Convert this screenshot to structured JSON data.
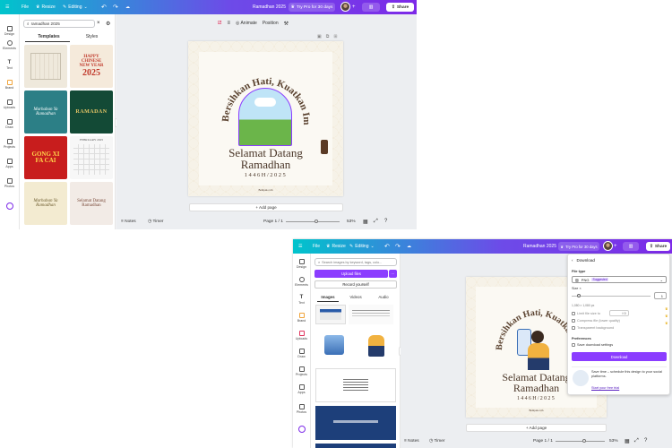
{
  "win1": {
    "topbar": {
      "file": "File",
      "resize": "Resize",
      "editing": "Editing",
      "doc_title": "Ramadhan 2025",
      "try_pro": "Try Pro for 30 days",
      "share": "Share"
    },
    "rail": [
      "Design",
      "Elements",
      "Text",
      "Brand",
      "Uploads",
      "Draw",
      "Projects",
      "Apps",
      "Photos"
    ],
    "search": {
      "value": "ramadhan 2025"
    },
    "tabs": {
      "templates": "Templates",
      "styles": "Styles"
    },
    "thumbs": [
      {
        "l1": "",
        "l2": "",
        "bg": "#efe9dc",
        "fg": "#7a6a55"
      },
      {
        "l1": "HAPPY CHINESE NEW YEAR",
        "l2": "2025",
        "bg": "#f5eadb",
        "fg": "#c0392b"
      },
      {
        "l1": "Marhaban Ya",
        "l2": "Ramadhan",
        "bg": "#2c7f86",
        "fg": "#ffffff"
      },
      {
        "l1": "RAMADAN",
        "l2": "",
        "bg": "#134a36",
        "fg": "#e8c766"
      },
      {
        "l1": "GONG XI",
        "l2": "FA CAI",
        "bg": "#c81d1d",
        "fg": "#ffd54a"
      },
      {
        "l1": "FEBRUARY 2025",
        "l2": "",
        "bg": "#f7f7f7",
        "fg": "#555555"
      },
      {
        "l1": "Marhaban Ya",
        "l2": "Ramadhan",
        "bg": "#f3ebd1",
        "fg": "#6b5a2c"
      },
      {
        "l1": "Selamat Datang",
        "l2": "Ramadhan",
        "bg": "#f2ebe6",
        "fg": "#7a4a3a"
      }
    ],
    "toolbar": {
      "animate": "Animate",
      "position": "Position"
    },
    "design": {
      "arc_text": "Bersihkan Hati, Kuatkan Iman",
      "title1": "Selamat Datang",
      "title2": "Ramadhan",
      "year": "1446H/2025",
      "brand": "Bempak.com"
    },
    "add_page": "+ Add page",
    "bottom": {
      "notes": "Notes",
      "timer": "Timer",
      "page": "Page 1 / 1",
      "zoom": "53%"
    }
  },
  "win2": {
    "topbar": {
      "file": "File",
      "resize": "Resize",
      "editing": "Editing",
      "doc_title": "Ramadhan 2025",
      "try_pro": "Try Pro for 30 days",
      "share": "Share"
    },
    "rail": [
      "Design",
      "Elements",
      "Text",
      "Brand",
      "Uploads",
      "Draw",
      "Projects",
      "Apps",
      "Photos"
    ],
    "search": {
      "placeholder": "Search images by keyword, tags, colo..."
    },
    "upload_files": "Upload files",
    "record": "Record yourself",
    "tabs": {
      "images": "Images",
      "videos": "Videos",
      "audio": "Audio"
    },
    "design": {
      "arc_text": "Bersihkan Hati, Kuatkan Iman",
      "title1": "Selamat Datang",
      "title2": "Ramadhan",
      "year": "1446H/2025",
      "brand": "Bempak.com"
    },
    "add_page": "+ Add page",
    "bottom": {
      "notes": "Notes",
      "timer": "Timer",
      "page": "Page 1 / 1",
      "zoom": "53%"
    },
    "download": {
      "title": "Download",
      "file_type_label": "File type",
      "file_type": "PNG",
      "suggested": "Suggested",
      "size_label": "Size ×",
      "size_value": "1",
      "dims": "1,080 × 1,080 px",
      "limit": "Limit file size to",
      "limit_unit": "KB",
      "compress": "Compress file (lower quality)",
      "transparent": "Transparent background",
      "prefs": "Preferences",
      "save_settings": "Save download settings",
      "button": "Download",
      "promo": "Save time – schedule this design to your social platforms.",
      "promo_link": "Start your free trial"
    }
  },
  "colors": {
    "accent": "#8b3dff",
    "topbar_from": "#00c4cc",
    "topbar_to": "#7d2ae8"
  }
}
